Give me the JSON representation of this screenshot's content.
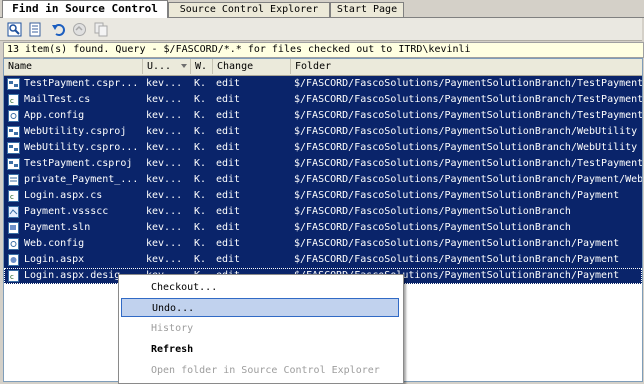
{
  "tabs": [
    {
      "label": "Find in Source Control"
    },
    {
      "label": "Source Control Explorer"
    },
    {
      "label": "Start Page"
    }
  ],
  "toolbar": {
    "buttons": [
      {
        "icon": "find-icon"
      },
      {
        "icon": "open-file-icon"
      },
      {
        "icon": "undo-icon"
      },
      {
        "icon": "disabled-action-icon"
      },
      {
        "icon": "copy-icon"
      }
    ]
  },
  "status": {
    "text": "13 item(s) found. Query - $/FASCORD/*.* for files checked out to ITRD\\kevinli"
  },
  "columns": {
    "name": "Name",
    "user": "U...",
    "workspace": "W.",
    "change": "Change",
    "folder": "Folder"
  },
  "rows": [
    {
      "name": "TestPayment.cspr...",
      "user": "kev...",
      "w": "K.",
      "change": "edit",
      "folder": "$/FASCORD/FascoSolutions/PaymentSolutionBranch/TestPayment",
      "icon": "project-icon"
    },
    {
      "name": "MailTest.cs",
      "user": "kev...",
      "w": "K.",
      "change": "edit",
      "folder": "$/FASCORD/FascoSolutions/PaymentSolutionBranch/TestPayment",
      "icon": "cs-file-icon"
    },
    {
      "name": "App.config",
      "user": "kev...",
      "w": "K.",
      "change": "edit",
      "folder": "$/FASCORD/FascoSolutions/PaymentSolutionBranch/TestPayment",
      "icon": "config-file-icon"
    },
    {
      "name": "WebUtility.csproj",
      "user": "kev...",
      "w": "K.",
      "change": "edit",
      "folder": "$/FASCORD/FascoSolutions/PaymentSolutionBranch/WebUtility",
      "icon": "project-icon"
    },
    {
      "name": "WebUtility.cspro...",
      "user": "kev...",
      "w": "K.",
      "change": "edit",
      "folder": "$/FASCORD/FascoSolutions/PaymentSolutionBranch/WebUtility",
      "icon": "project-icon"
    },
    {
      "name": "TestPayment.csproj",
      "user": "kev...",
      "w": "K.",
      "change": "edit",
      "folder": "$/FASCORD/FascoSolutions/PaymentSolutionBranch/TestPayment",
      "icon": "project-icon"
    },
    {
      "name": "private_Payment_...",
      "user": "kev...",
      "w": "K.",
      "change": "edit",
      "folder": "$/FASCORD/FascoSolutions/PaymentSolutionBranch/Payment/WebRes",
      "icon": "file-icon"
    },
    {
      "name": "Login.aspx.cs",
      "user": "kev...",
      "w": "K.",
      "change": "edit",
      "folder": "$/FASCORD/FascoSolutions/PaymentSolutionBranch/Payment",
      "icon": "cs-file-icon"
    },
    {
      "name": "Payment.vssscc",
      "user": "kev...",
      "w": "K.",
      "change": "edit",
      "folder": "$/FASCORD/FascoSolutions/PaymentSolutionBranch",
      "icon": "scc-file-icon"
    },
    {
      "name": "Payment.sln",
      "user": "kev...",
      "w": "K.",
      "change": "edit",
      "folder": "$/FASCORD/FascoSolutions/PaymentSolutionBranch",
      "icon": "solution-file-icon"
    },
    {
      "name": "Web.config",
      "user": "kev...",
      "w": "K.",
      "change": "edit",
      "folder": "$/FASCORD/FascoSolutions/PaymentSolutionBranch/Payment",
      "icon": "config-file-icon"
    },
    {
      "name": "Login.aspx",
      "user": "kev...",
      "w": "K.",
      "change": "edit",
      "folder": "$/FASCORD/FascoSolutions/PaymentSolutionBranch/Payment",
      "icon": "aspx-file-icon"
    },
    {
      "name": "Login.aspx.desig",
      "user": "kev...",
      "w": "K.",
      "change": "edit",
      "folder": "$/FASCORD/FascoSolutions/PaymentSolutionBranch/Payment",
      "icon": "cs-file-icon"
    }
  ],
  "context_menu": {
    "items": [
      {
        "label": "Checkout...",
        "state": "normal"
      },
      {
        "label": "Undo...",
        "state": "selected"
      },
      {
        "label": "History",
        "state": "disabled"
      },
      {
        "label": "Refresh",
        "state": "bold"
      },
      {
        "label": "Open folder in Source Control Explorer",
        "state": "disabled"
      }
    ]
  },
  "colors": {
    "selection": "#0a246a",
    "menu_highlight": "#c1d2ee",
    "status_bg": "#ffffe1"
  }
}
